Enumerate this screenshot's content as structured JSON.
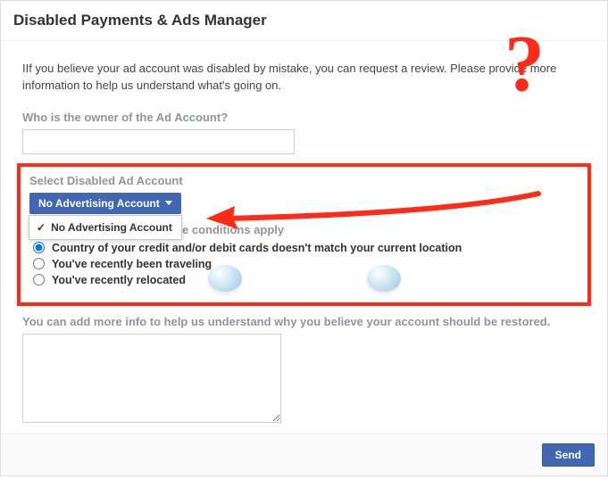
{
  "header": {
    "title": "Disabled Payments & Ads Manager"
  },
  "intro": "IIf you believe your ad account was disabled by mistake, you can request a review. Please provide more information to help us understand what's going on.",
  "owner": {
    "label": "Who is the owner of the Ad Account?",
    "value": ""
  },
  "select": {
    "label": "Select Disabled Ad Account",
    "button": "No Advertising Account",
    "options": [
      {
        "label": "No Advertising Account",
        "checked": true
      }
    ]
  },
  "conditions": {
    "lead_partial": "e conditions apply",
    "items": [
      {
        "label": "Country of your credit and/or debit cards doesn't match your current location",
        "checked": true
      },
      {
        "label": "You've recently been traveling",
        "checked": false
      },
      {
        "label": "You've recently relocated",
        "checked": false
      }
    ]
  },
  "more_info": {
    "label": "You can add more info to help us understand why you believe your account should be restored.",
    "value": ""
  },
  "footer": {
    "send": "Send"
  },
  "annotation": {
    "question": "?"
  }
}
